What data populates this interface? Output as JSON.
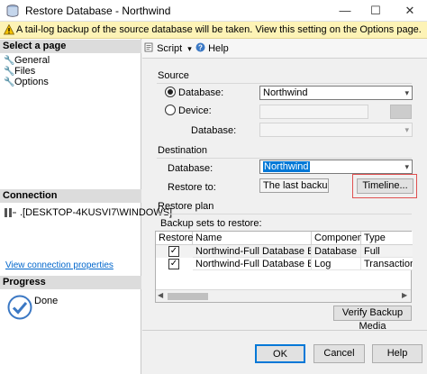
{
  "window": {
    "title": "Restore Database - Northwind",
    "min_glyph": "—",
    "max_glyph": "☐",
    "close_glyph": "✕"
  },
  "warning": {
    "text": "A tail-log backup of the source database will be taken. View this setting on the Options page."
  },
  "left": {
    "select_page_header": "Select a page",
    "pages": [
      "General",
      "Files",
      "Options"
    ],
    "connection_header": "Connection",
    "connection_text": ".[DESKTOP-4KUSVI7\\WINDOWS]",
    "view_connection_link": "View connection properties",
    "progress_header": "Progress",
    "progress_status": "Done"
  },
  "toolbar": {
    "script_label": "Script",
    "script_caret": "▾",
    "help_label": "Help"
  },
  "source": {
    "label": "Source",
    "database_radio_label": "Database:",
    "database_value": "Northwind",
    "device_radio_label": "Device:",
    "device_value": "",
    "device_database_label": "Database:",
    "device_database_value": ""
  },
  "destination": {
    "label": "Destination",
    "database_label": "Database:",
    "database_value": "Northwind",
    "restore_to_label": "Restore to:",
    "restore_to_value": "The last backup take",
    "timeline_button": "Timeline..."
  },
  "restore_plan": {
    "label": "Restore plan",
    "backup_sets_label": "Backup sets to restore:",
    "columns": [
      "Restore",
      "Name",
      "Component",
      "Type"
    ],
    "rows": [
      {
        "restore": true,
        "name": "Northwind-Full Database Backup",
        "component": "Database",
        "type": "Full"
      },
      {
        "restore": true,
        "name": "Northwind-Full Database Backup",
        "component": "Log",
        "type": "Transaction Log"
      }
    ],
    "verify_button": "Verify Backup Media"
  },
  "footer": {
    "ok_button": "OK",
    "cancel_button": "Cancel",
    "help_button": "Help"
  },
  "colors": {
    "warning_bg": "#fdf3b6",
    "selection_blue": "#0078d7",
    "link_blue": "#0066cc",
    "highlight_red": "#e05050"
  }
}
